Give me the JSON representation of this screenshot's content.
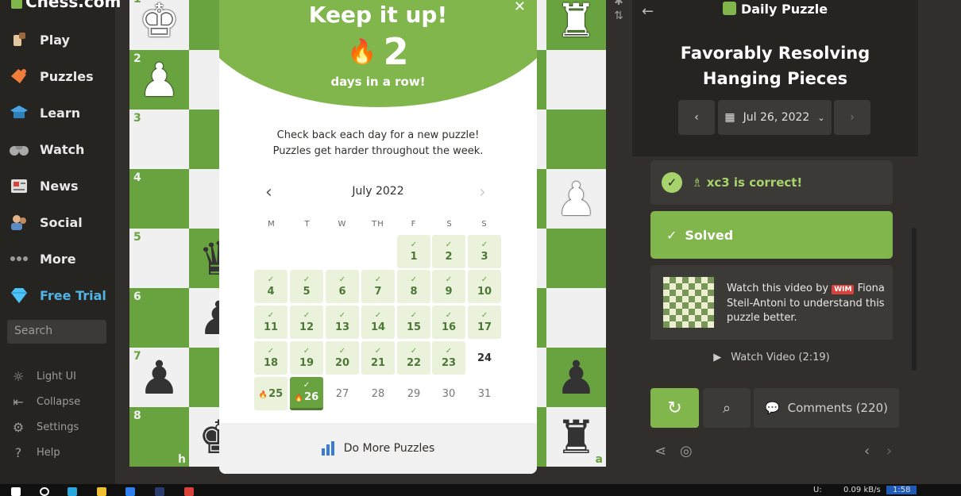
{
  "sidebar": {
    "logo": "Chess.com",
    "items": [
      {
        "label": "Play",
        "icon": "play-icon"
      },
      {
        "label": "Puzzles",
        "icon": "puzzles-icon"
      },
      {
        "label": "Learn",
        "icon": "learn-icon"
      },
      {
        "label": "Watch",
        "icon": "watch-icon"
      },
      {
        "label": "News",
        "icon": "news-icon"
      },
      {
        "label": "Social",
        "icon": "social-icon"
      },
      {
        "label": "More",
        "icon": "more-icon"
      },
      {
        "label": "Free Trial",
        "icon": "diamond-icon"
      }
    ],
    "search_placeholder": "Search",
    "bottom": [
      {
        "label": "Light UI",
        "icon": "light-ui-icon"
      },
      {
        "label": "Collapse",
        "icon": "collapse-icon"
      },
      {
        "label": "Settings",
        "icon": "gear-icon"
      },
      {
        "label": "Help",
        "icon": "help-icon"
      }
    ]
  },
  "board": {
    "ranks": [
      "1",
      "2",
      "3",
      "4",
      "5",
      "6",
      "7",
      "8"
    ],
    "files": [
      "h",
      "a"
    ]
  },
  "modal": {
    "title": "Keep it up!",
    "streak": "2",
    "streak_sub": "days in a row!",
    "desc_line1": "Check back each day for a new puzzle!",
    "desc_line2": "Puzzles get harder throughout the week.",
    "month": "July 2022",
    "weekdays": [
      "M",
      "T",
      "W",
      "TH",
      "F",
      "S",
      "S"
    ],
    "footer": "Do More Puzzles"
  },
  "calendar_days": [
    {
      "d": "1",
      "s": "solved"
    },
    {
      "d": "2",
      "s": "solved"
    },
    {
      "d": "3",
      "s": "solved"
    },
    {
      "d": "4",
      "s": "solved"
    },
    {
      "d": "5",
      "s": "solved"
    },
    {
      "d": "6",
      "s": "solved"
    },
    {
      "d": "7",
      "s": "solved"
    },
    {
      "d": "8",
      "s": "solved"
    },
    {
      "d": "9",
      "s": "solved"
    },
    {
      "d": "10",
      "s": "solved"
    },
    {
      "d": "11",
      "s": "solved"
    },
    {
      "d": "12",
      "s": "solved"
    },
    {
      "d": "13",
      "s": "solved"
    },
    {
      "d": "14",
      "s": "solved"
    },
    {
      "d": "15",
      "s": "solved"
    },
    {
      "d": "16",
      "s": "solved"
    },
    {
      "d": "17",
      "s": "solved"
    },
    {
      "d": "18",
      "s": "solved"
    },
    {
      "d": "19",
      "s": "solved"
    },
    {
      "d": "20",
      "s": "solved"
    },
    {
      "d": "21",
      "s": "solved"
    },
    {
      "d": "22",
      "s": "solved"
    },
    {
      "d": "23",
      "s": "solved"
    },
    {
      "d": "24",
      "s": "plain"
    },
    {
      "d": "25",
      "s": "streak"
    },
    {
      "d": "26",
      "s": "today"
    },
    {
      "d": "27",
      "s": "future"
    },
    {
      "d": "28",
      "s": "future"
    },
    {
      "d": "29",
      "s": "future"
    },
    {
      "d": "30",
      "s": "future"
    },
    {
      "d": "31",
      "s": "future"
    }
  ],
  "panel": {
    "label": "Daily Puzzle",
    "title_line1": "Favorably Resolving",
    "title_line2": "Hanging Pieces",
    "date": "Jul 26, 2022",
    "correct": "xc3 is correct!",
    "solved": "Solved",
    "video_pre": "Watch this video by",
    "video_title_badge": "WIM",
    "video_post": "Fiona Steil-Antoni to understand this puzzle better.",
    "watch": "Watch Video (2:19)",
    "comments": "Comments  (220)"
  },
  "taskbar": {
    "net_label": "U:",
    "net_speed": "0.09 kB/s",
    "clock": "1:58"
  },
  "colors": {
    "accent": "#81b64c",
    "board_dark": "#69a33f",
    "board_light": "#f0f0f0",
    "panel_bg": "#262421"
  }
}
